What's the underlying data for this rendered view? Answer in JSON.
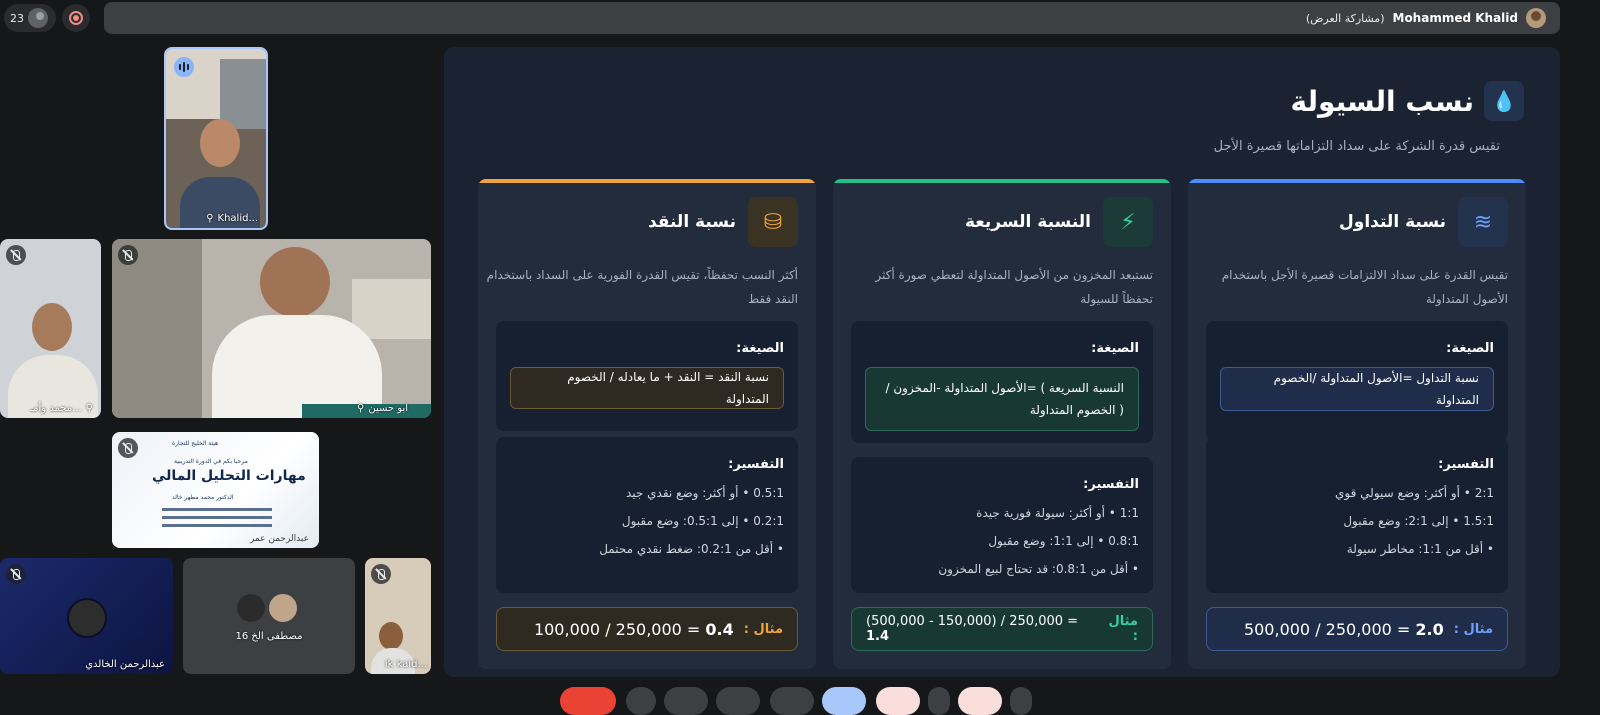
{
  "topbar": {
    "participant_count": "23",
    "presenter_name": "Mohammed Khalid",
    "presenter_sub": "(مشاركة العرض)"
  },
  "tiles": {
    "speaker_label": "Khalid...",
    "tile2_label": "محمد وأمـ...",
    "tile3_label": "ابو حسين",
    "slide_tile": {
      "org": "هيئة الخليج للتجارة",
      "welcome": "مرحبا بكم في الدورة التدريبية",
      "course": "مهارات التحليل المالي",
      "presenter": "الدكتور محمد مطهر خالد",
      "owner_label": "عبدالرحمن عمر"
    },
    "tile5_label": "عبدالرحمن الخالدي",
    "tile6_label": "16 مصطفى الخ",
    "tile7_label": "ik kaid..."
  },
  "slide": {
    "title": "نسب السيولة",
    "subtitle": "تقيس قدرة الشركة على سداد التزاماتها قصيرة الأجل",
    "formula_label": "الصيغة:",
    "interp_label": "التفسير:",
    "example_label": "مثال :",
    "cards": [
      {
        "title": "نسبة التداول",
        "desc": "تقيس القدرة على سداد الالتزامات قصيرة الأجل باستخدام الأصول المتداولة",
        "formula": "نسبة التداول =الأصول المتداولة /الخصوم المتداولة",
        "interp": [
          "2:1 • أو أكثر: وضع سيولي قوي",
          "1.5:1 • إلى 2:1: وضع مقبول",
          "• أقل من 1:1: مخاطر سيولة"
        ],
        "example_expr": "500,000 / 250,000 = ",
        "example_result": "2.0",
        "accent": "#4f8cf7"
      },
      {
        "title": "النسبة السريعة",
        "desc": "تستبعد المخزون من الأصول المتداولة لتعطي صورة أكثر تحفظاً للسيولة",
        "formula": "النسبة السريعة ) =الأصول المتداولة -المخزون / ( الخصوم المتداولة",
        "interp": [
          "1:1 • أو أكثر: سيولة فورية جيدة",
          "0.8:1 • إلى 1:1: وضع مقبول",
          "• أقل من 0.8:1: قد تحتاج لبيع المخزون"
        ],
        "example_expr": "(500,000 - 150,000) / 250,000 = ",
        "example_result": "1.4",
        "accent": "#22c08a"
      },
      {
        "title": "نسبة النقد",
        "desc": "أكثر النسب تحفظاً، تقيس القدرة الفورية على السداد باستخدام النقد فقط",
        "formula": "نسبة النقد = النقد + ما يعادله / الخصوم المتداولة",
        "interp": [
          "0.5:1 • أو أكثر: وضع نقدي جيد",
          "0.2:1 • إلى 0.5:1: وضع مقبول",
          "• أقل من 0.2:1: ضغط نقدي محتمل"
        ],
        "example_expr": "100,000 / 250,000 = ",
        "example_result": "0.4",
        "accent": "#f0a43a"
      }
    ]
  }
}
